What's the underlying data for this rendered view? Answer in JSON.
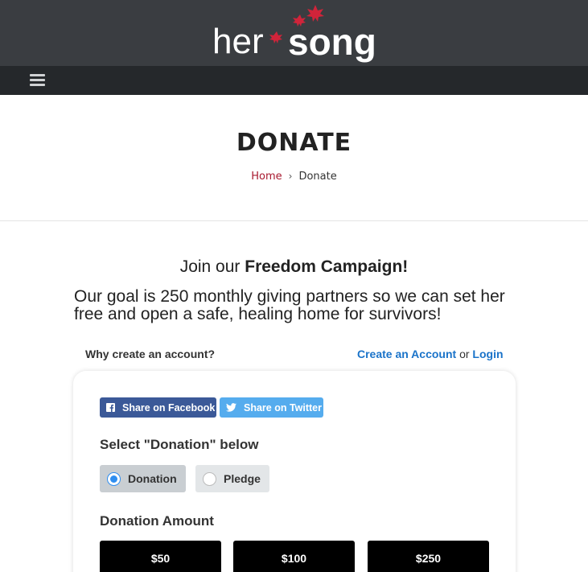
{
  "brand": {
    "logo_text_left": "her",
    "logo_text_right": "song",
    "accent_color": "#d0243a"
  },
  "nav": {
    "menu_icon": "hamburger-icon"
  },
  "page": {
    "title": "DONATE",
    "breadcrumb": {
      "home": "Home",
      "separator": "›",
      "current": "Donate"
    }
  },
  "campaign": {
    "join_prefix": "Join our ",
    "join_bold": "Freedom Campaign!",
    "goal": "Our goal is 250 monthly giving partners so we can set her free and open a safe, healing home for survivors!"
  },
  "account": {
    "why": "Why create an account?",
    "create": "Create an Account",
    "or": "or",
    "login": "Login"
  },
  "share": {
    "facebook": "Share on Facebook",
    "twitter": "Share on Twitter",
    "facebook_color": "#3b5998",
    "twitter_color": "#55acee"
  },
  "form": {
    "select_title": "Select \"Donation\" below",
    "options": [
      {
        "label": "Donation",
        "selected": true
      },
      {
        "label": "Pledge",
        "selected": false
      }
    ],
    "amount_title": "Donation Amount",
    "amounts": [
      "$50",
      "$100",
      "$250"
    ]
  }
}
